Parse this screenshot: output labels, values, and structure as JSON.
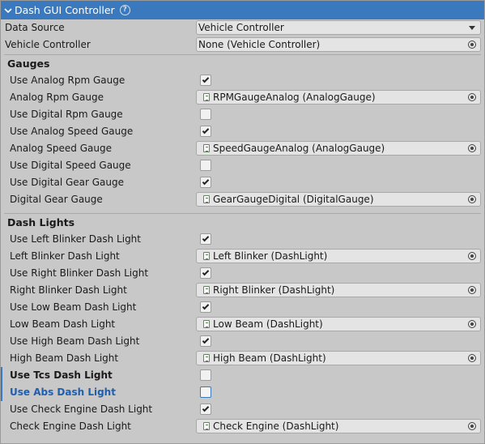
{
  "header": {
    "title": "Dash GUI Controller",
    "help_icon": "?"
  },
  "top": {
    "data_source": {
      "label": "Data Source",
      "value": "Vehicle Controller"
    },
    "vehicle_controller": {
      "label": "Vehicle Controller",
      "value": "None (Vehicle Controller)"
    }
  },
  "gauges": {
    "title": "Gauges",
    "rows": [
      {
        "label": "Use Analog Rpm Gauge",
        "checked": true
      },
      {
        "label": "Analog Rpm Gauge",
        "value": "RPMGaugeAnalog (AnalogGauge)"
      },
      {
        "label": "Use Digital Rpm Gauge",
        "checked": false
      },
      {
        "label": "Use Analog Speed Gauge",
        "checked": true
      },
      {
        "label": "Analog Speed Gauge",
        "value": "SpeedGaugeAnalog (AnalogGauge)"
      },
      {
        "label": "Use Digital Speed Gauge",
        "checked": false
      },
      {
        "label": "Use Digital Gear Gauge",
        "checked": true
      },
      {
        "label": "Digital Gear Gauge",
        "value": "GearGaugeDigital (DigitalGauge)"
      }
    ]
  },
  "dash_lights": {
    "title": "Dash Lights",
    "rows": [
      {
        "label": "Use Left Blinker Dash Light",
        "checked": true
      },
      {
        "label": "Left Blinker Dash Light",
        "value": "Left Blinker (DashLight)"
      },
      {
        "label": "Use Right Blinker Dash Light",
        "checked": true
      },
      {
        "label": "Right Blinker Dash Light",
        "value": "Right Blinker (DashLight)"
      },
      {
        "label": "Use Low Beam Dash Light",
        "checked": true
      },
      {
        "label": "Low Beam Dash Light",
        "value": "Low Beam (DashLight)"
      },
      {
        "label": "Use High Beam Dash Light",
        "checked": true
      },
      {
        "label": "High Beam Dash Light",
        "value": "High Beam (DashLight)"
      },
      {
        "label": "Use Tcs Dash Light",
        "checked": false
      },
      {
        "label": "Use Abs Dash Light",
        "checked": false
      },
      {
        "label": "Use Check Engine Dash Light",
        "checked": true
      },
      {
        "label": "Check Engine Dash Light",
        "value": "Check Engine (DashLight)"
      }
    ]
  },
  "colors": {
    "header_bg": "#3a79bd",
    "panel_bg": "#c8c8c8",
    "highlight_label": "#1f5fb0"
  }
}
